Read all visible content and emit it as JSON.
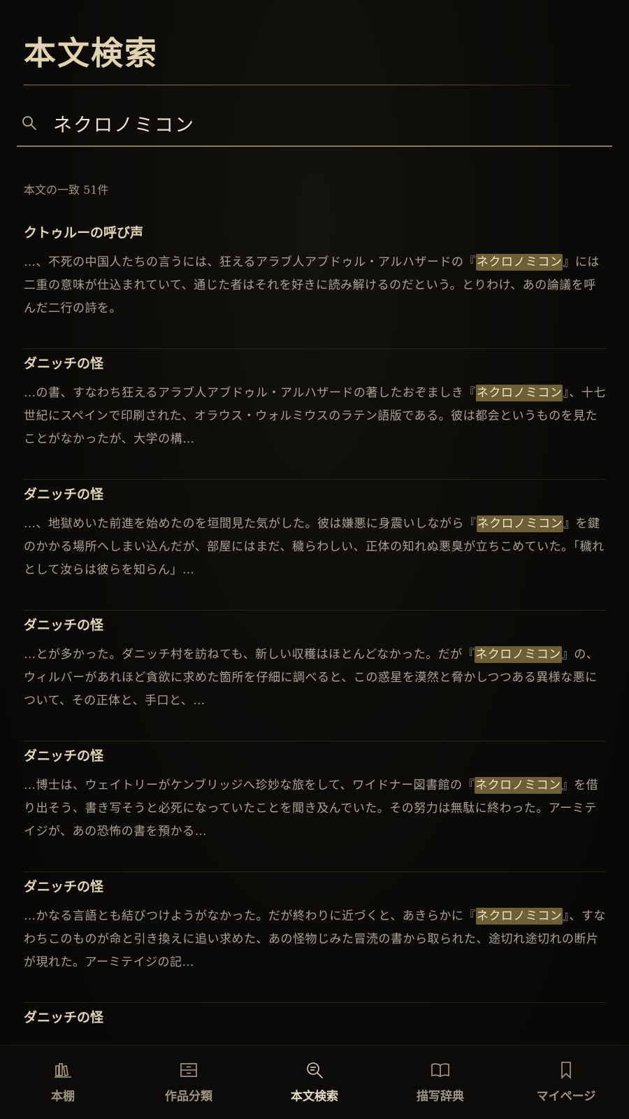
{
  "header": {
    "title": "本文検索"
  },
  "search": {
    "value": "ネクロノミコン",
    "placeholder": ""
  },
  "results_summary": "本文の一致 51件",
  "results": [
    {
      "title": "クトゥルーの呼び声",
      "before": "…、不死の中国人たちの言うには、狂えるアラブ人アブドゥル・アルハザードの『",
      "match": "ネクロノミコン",
      "after": "』には二重の意味が仕込まれていて、通じた者はそれを好きに読み解けるのだという。とりわけ、あの論議を呼んだ二行の詩を。"
    },
    {
      "title": "ダニッチの怪",
      "before": "…の書、すなわち狂えるアラブ人アブドゥル・アルハザードの著したおぞましき『",
      "match": "ネクロノミコン",
      "after": "』、十七世紀にスペインで印刷された、オラウス・ウォルミウスのラテン語版である。彼は都会というものを見たことがなかったが、大学の構…"
    },
    {
      "title": "ダニッチの怪",
      "before": "…、地獄めいた前進を始めたのを垣間見た気がした。彼は嫌悪に身震いしながら『",
      "match": "ネクロノミコン",
      "after": "』を鍵のかかる場所へしまい込んだが、部屋にはまだ、穢らわしい、正体の知れぬ悪臭が立ちこめていた。「穢れとして汝らは彼らを知らん」…"
    },
    {
      "title": "ダニッチの怪",
      "before": "…とが多かった。ダニッチ村を訪ねても、新しい収穫はほとんどなかった。だが『",
      "match": "ネクロノミコン",
      "after": "』の、ウィルバーがあれほど貪欲に求めた箇所を仔細に調べると、この惑星を漠然と脅かしつつある異様な悪について、その正体と、手口と、…"
    },
    {
      "title": "ダニッチの怪",
      "before": "…博士は、ウェイトリーがケンブリッジへ珍妙な旅をして、ワイドナー図書館の『",
      "match": "ネクロノミコン",
      "after": "』を借り出そう、書き写そうと必死になっていたことを聞き及んでいた。その努力は無駄に終わった。アーミテイジが、あの恐怖の書を預かる…"
    },
    {
      "title": "ダニッチの怪",
      "before": "…かなる言語とも結びつけようがなかった。だが終わりに近づくと、あきらかに『",
      "match": "ネクロノミコン",
      "after": "』、すなわちこのものが命と引き換えに追い求めた、あの怪物じみた冒涜の書から取られた、途切れ途切れの断片が現れた。アーミテイジの記…"
    },
    {
      "title": "ダニッチの怪",
      "before": "",
      "match": "",
      "after": ""
    }
  ],
  "nav": [
    {
      "label": "本棚",
      "icon": "bookshelf-icon",
      "active": false
    },
    {
      "label": "作品分類",
      "icon": "cabinet-icon",
      "active": false
    },
    {
      "label": "本文検索",
      "icon": "text-search-icon",
      "active": true
    },
    {
      "label": "描写辞典",
      "icon": "open-book-icon",
      "active": false
    },
    {
      "label": "マイページ",
      "icon": "bookmark-icon",
      "active": false
    }
  ],
  "colors": {
    "accent": "#8d7a4e",
    "highlight": "#6e5f35",
    "background": "#0b0a08"
  }
}
